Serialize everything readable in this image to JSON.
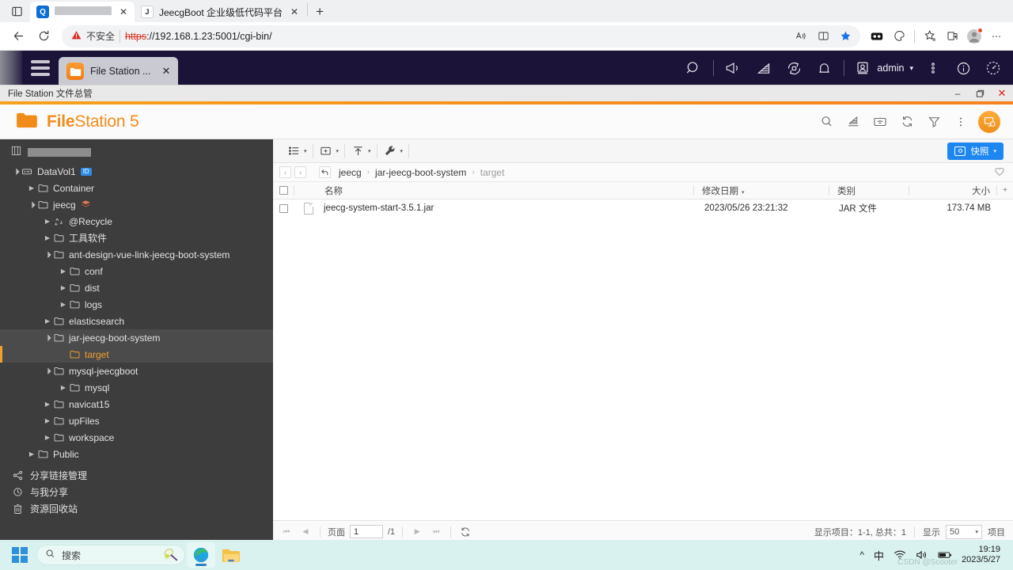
{
  "browser": {
    "tabs": [
      {
        "title": "",
        "masked": true,
        "favicon": "qnap-icon",
        "active": true
      },
      {
        "title": "JeecgBoot 企业级低代码平台",
        "masked": false,
        "favicon": "jeecg-icon",
        "active": false
      }
    ],
    "new_tab_label": "+",
    "close_label": "✕",
    "back_icon": "back-arrow-icon",
    "reload_icon": "reload-icon",
    "security_warning": "不安全",
    "url_scheme": "https",
    "url_rest": "://192.168.1.23:5001/cgi-bin/",
    "url_host": "192.168.1.23",
    "url_port_path": ":5001/cgi-bin/",
    "toolbar_icons": [
      "read-aloud-icon",
      "split-screen-icon",
      "favorite-star-icon",
      "collections-icon",
      "browser-essentials-icon",
      "add-favorite-icon",
      "collections-add-icon",
      "profile-avatar-icon",
      "settings-more-icon"
    ]
  },
  "dsm": {
    "hamburger": "main-menu-icon",
    "app_tab_label": "File Station ...",
    "app_tab_close": "✕",
    "icons": [
      "search-icon",
      "notification-broadcast-icon",
      "package-center-icon",
      "support-center-icon",
      "bell-icon"
    ],
    "user_name": "admin",
    "user_caret": "▾",
    "right_icons": [
      "options-icon",
      "info-icon",
      "widget-icon"
    ]
  },
  "window": {
    "title": "File Station 文件总管",
    "minimize": "–",
    "restore": "❐",
    "close": "✕"
  },
  "app": {
    "logo_bold": "File",
    "logo_rest": "Station 5",
    "logo_icon": "folder-icon",
    "header_icons": [
      "search-icon",
      "package-install-icon",
      "remote-connection-icon",
      "refresh-icon",
      "filter-icon",
      "more-options-icon",
      "help-assistant-icon"
    ]
  },
  "toolbar": {
    "view_icon": "list-view-icon",
    "create_icon": "new-folder-icon",
    "upload_icon": "upload-icon",
    "tools_icon": "wrench-tools-icon",
    "caret": "▾",
    "snapshot_label": "快照",
    "snapshot_caret": "▾",
    "snapshot_icon": "camera-icon",
    "snapshot_color": "#1e86f0"
  },
  "breadcrumb": {
    "back_icon": "‹",
    "forward_icon": "›",
    "up_icon": "↰",
    "items": [
      "jeecg",
      "jar-jeecg-boot-system",
      "target"
    ],
    "separator": "›",
    "favorite_icon": "heart-icon"
  },
  "sidebar": {
    "header_masked": true,
    "header_icon": "server-icon",
    "tree": [
      {
        "label": "DataVol1",
        "depth": 0,
        "icon": "volume-icon",
        "arrow": "open",
        "badge": "ID"
      },
      {
        "label": "Container",
        "depth": 1,
        "icon": "folder-icon",
        "arrow": "closed",
        "badge": ""
      },
      {
        "label": "jeecg",
        "depth": 1,
        "icon": "folder-icon",
        "arrow": "open",
        "badge": "",
        "extra_icon": "stack-icon"
      },
      {
        "label": "@Recycle",
        "depth": 2,
        "icon": "recycle-icon",
        "arrow": "closed",
        "badge": ""
      },
      {
        "label": "工具软件",
        "depth": 2,
        "icon": "folder-icon",
        "arrow": "closed",
        "badge": ""
      },
      {
        "label": "ant-design-vue-link-jeecg-boot-system",
        "depth": 2,
        "icon": "folder-icon",
        "arrow": "open",
        "badge": ""
      },
      {
        "label": "conf",
        "depth": 3,
        "icon": "folder-icon",
        "arrow": "closed",
        "badge": ""
      },
      {
        "label": "dist",
        "depth": 3,
        "icon": "folder-icon",
        "arrow": "closed",
        "badge": ""
      },
      {
        "label": "logs",
        "depth": 3,
        "icon": "folder-icon",
        "arrow": "closed",
        "badge": ""
      },
      {
        "label": "elasticsearch",
        "depth": 2,
        "icon": "folder-icon",
        "arrow": "closed",
        "badge": ""
      },
      {
        "label": "jar-jeecg-boot-system",
        "depth": 2,
        "icon": "folder-icon",
        "arrow": "open",
        "badge": "",
        "selected": true
      },
      {
        "label": "target",
        "depth": 3,
        "icon": "folder-icon",
        "arrow": "none",
        "badge": "",
        "current": true
      },
      {
        "label": "mysql-jeecgboot",
        "depth": 2,
        "icon": "folder-icon",
        "arrow": "open",
        "badge": ""
      },
      {
        "label": "mysql",
        "depth": 3,
        "icon": "folder-icon",
        "arrow": "closed",
        "badge": ""
      },
      {
        "label": "navicat15",
        "depth": 2,
        "icon": "folder-icon",
        "arrow": "closed",
        "badge": ""
      },
      {
        "label": "upFiles",
        "depth": 2,
        "icon": "folder-icon",
        "arrow": "closed",
        "badge": ""
      },
      {
        "label": "workspace",
        "depth": 2,
        "icon": "folder-icon",
        "arrow": "closed",
        "badge": ""
      },
      {
        "label": "Public",
        "depth": 1,
        "icon": "folder-icon",
        "arrow": "closed",
        "badge": ""
      }
    ],
    "bottom_items": [
      {
        "label": "分享链接管理",
        "icon": "share-link-icon"
      },
      {
        "label": "与我分享",
        "icon": "shared-with-me-icon"
      },
      {
        "label": "资源回收站",
        "icon": "recycle-bin-icon"
      }
    ]
  },
  "filelist": {
    "columns": [
      "名称",
      "修改日期",
      "类别",
      "大小"
    ],
    "sort_column": "修改日期",
    "sort_caret": "▾",
    "add_column_icon": "+",
    "rows": [
      {
        "name": "jeecg-system-start-3.5.1.jar",
        "modified": "2023/05/26 23:21:32",
        "type": "JAR 文件",
        "size": "173.74 MB",
        "icon": "file-icon",
        "checked": false
      }
    ]
  },
  "status": {
    "first_page_icon": "⏮",
    "prev_page_icon": "◀",
    "page_label": "页面",
    "page_value": "1",
    "page_total": "/1",
    "next_page_icon": "▶",
    "last_page_icon": "⏭",
    "refresh_icon": "refresh-icon",
    "items_info": "显示项目：1-1, 总共：1",
    "show_label": "显示",
    "page_size": "50",
    "page_size_caret": "▾",
    "items_suffix": "项目"
  },
  "taskbar": {
    "start_icon": "windows-start-icon",
    "search_placeholder": "搜索",
    "search_icon": "search-icon",
    "search_badge_icon": "badminton-icon",
    "apps": [
      {
        "name": "edge-icon",
        "active": true
      },
      {
        "name": "file-explorer-icon",
        "active": false
      }
    ],
    "tray": {
      "overflow_icon": "^",
      "ime_label": "中",
      "wifi_icon": "wifi-icon",
      "volume_icon": "volume-icon",
      "battery_icon": "battery-icon",
      "time": "19:19",
      "date": "2023/5/27"
    },
    "watermark": "CSDN @Scooter"
  },
  "colors": {
    "accent_orange": "#f28c18",
    "dsm_navy": "#1b1338",
    "snapshot_blue": "#1e86f0",
    "sidebar_dark": "#3d3d3d",
    "taskbar_mint": "#d9f2ef"
  }
}
